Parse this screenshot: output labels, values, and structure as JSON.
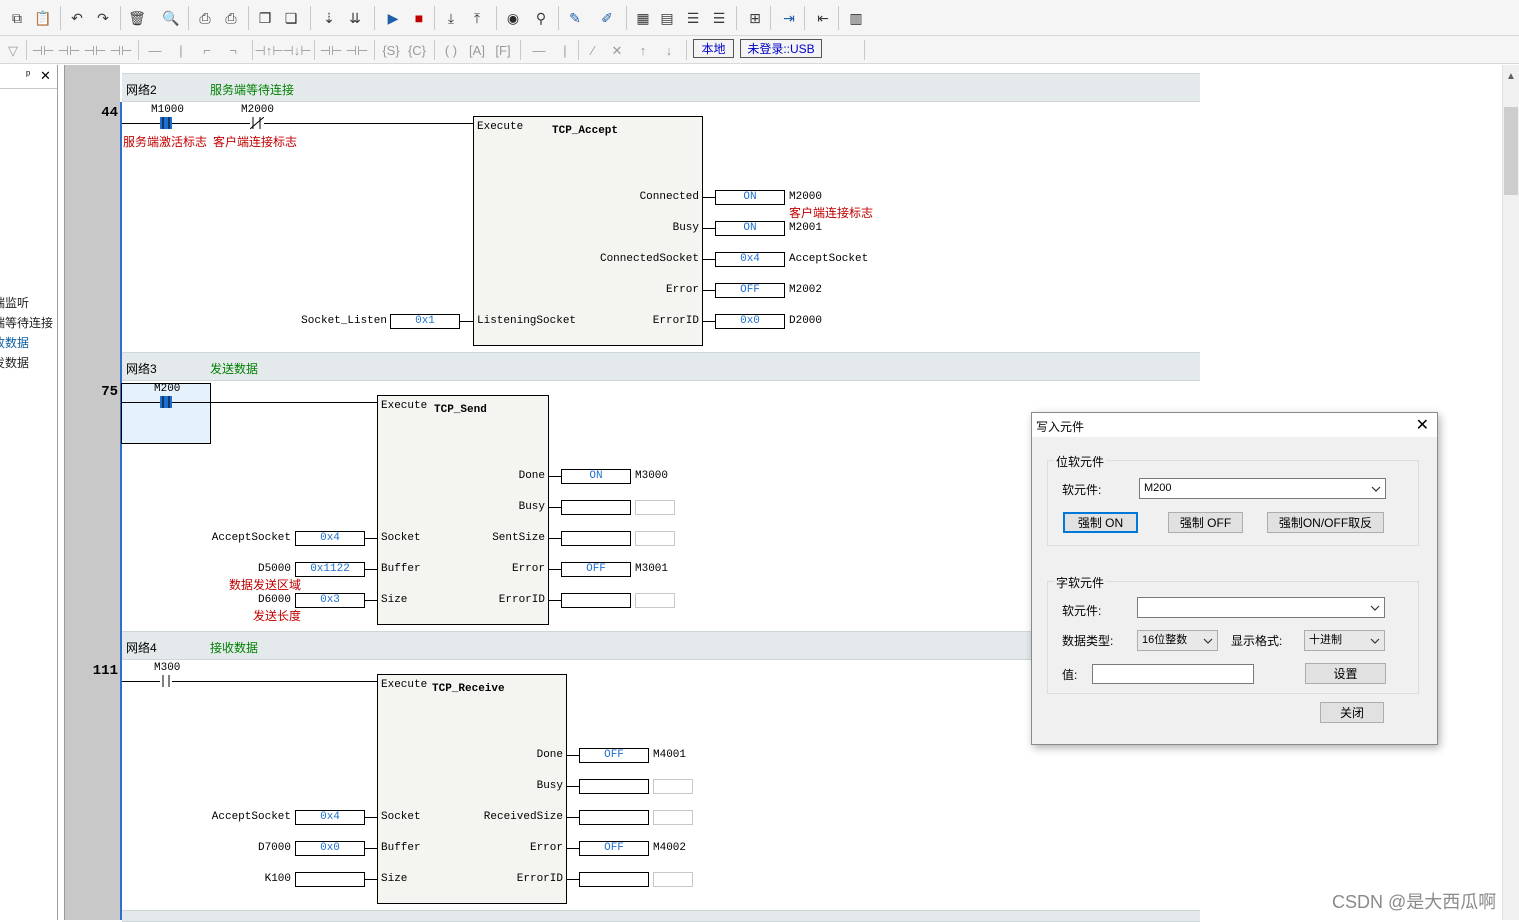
{
  "toolbar": {
    "mode_buttons": [
      {
        "label": "本地"
      },
      {
        "label": "未登录::USB"
      }
    ]
  },
  "left_panel": {
    "items": [
      {
        "label": "端监听"
      },
      {
        "label": "端等待连接"
      },
      {
        "label": "收数据"
      },
      {
        "label": "发数据"
      }
    ]
  },
  "networks": [
    {
      "title": "网络2",
      "comment": "服务端等待连接",
      "row": "44",
      "contacts": [
        {
          "tag": "M1000",
          "comment": "服务端激活标志"
        },
        {
          "tag": "M2000",
          "comment": "客户端连接标志"
        }
      ],
      "block": {
        "name": "TCP_Accept",
        "execute": "Execute",
        "inputs": [
          {
            "source": "Socket_Listen",
            "value": "0x1",
            "pin": "ListeningSocket"
          }
        ],
        "outputs": [
          {
            "pin": "Connected",
            "value": "ON",
            "target": "M2000",
            "comment": "客户端连接标志"
          },
          {
            "pin": "Busy",
            "value": "ON",
            "target": "M2001"
          },
          {
            "pin": "ConnectedSocket",
            "value": "0x4",
            "target": "AcceptSocket"
          },
          {
            "pin": "Error",
            "value": "OFF",
            "target": "M2002"
          },
          {
            "pin": "ErrorID",
            "value": "0x0",
            "target": "D2000"
          }
        ]
      }
    },
    {
      "title": "网络3",
      "comment": "发送数据",
      "row": "75",
      "contacts": [
        {
          "tag": "M200"
        }
      ],
      "block": {
        "name": "TCP_Send",
        "execute": "Execute",
        "inputs": [
          {
            "source": "AcceptSocket",
            "value": "0x4",
            "pin": "Socket"
          },
          {
            "source": "D5000",
            "value": "0x1122",
            "pin": "Buffer",
            "comment": "数据发送区域"
          },
          {
            "source": "D6000",
            "value": "0x3",
            "pin": "Size",
            "comment": "发送长度"
          }
        ],
        "outputs": [
          {
            "pin": "Done",
            "value": "ON",
            "target": "M3000"
          },
          {
            "pin": "Busy",
            "value": "",
            "target": ""
          },
          {
            "pin": "SentSize",
            "value": "",
            "target": ""
          },
          {
            "pin": "Error",
            "value": "OFF",
            "target": "M3001"
          },
          {
            "pin": "ErrorID",
            "value": "",
            "target": ""
          }
        ]
      }
    },
    {
      "title": "网络4",
      "comment": "接收数据",
      "row": "111",
      "contacts": [
        {
          "tag": "M300"
        }
      ],
      "block": {
        "name": "TCP_Receive",
        "execute": "Execute",
        "inputs": [
          {
            "source": "AcceptSocket",
            "value": "0x4",
            "pin": "Socket"
          },
          {
            "source": "D7000",
            "value": "0x0",
            "pin": "Buffer"
          },
          {
            "source": "K100",
            "value": "",
            "pin": "Size"
          }
        ],
        "outputs": [
          {
            "pin": "Done",
            "value": "OFF",
            "target": "M4001"
          },
          {
            "pin": "Busy",
            "value": "",
            "target": ""
          },
          {
            "pin": "ReceivedSize",
            "value": "",
            "target": ""
          },
          {
            "pin": "Error",
            "value": "OFF",
            "target": "M4002"
          },
          {
            "pin": "ErrorID",
            "value": "",
            "target": ""
          }
        ]
      }
    }
  ],
  "dialog": {
    "title": "写入元件",
    "bit_group": {
      "title": "位软元件",
      "device_label": "软元件:",
      "device_value": "M200",
      "buttons": [
        {
          "label": "强制 ON"
        },
        {
          "label": "强制 OFF"
        },
        {
          "label": "强制ON/OFF取反"
        }
      ]
    },
    "word_group": {
      "title": "字软元件",
      "device_label": "软元件:",
      "device_value": "",
      "type_label": "数据类型:",
      "type_value": "16位整数",
      "format_label": "显示格式:",
      "format_value": "十进制",
      "value_label": "值:",
      "value_value": "",
      "set_button": "设置"
    },
    "close_button": "关闭"
  },
  "watermark": "CSDN @是大西瓜啊",
  "colors": {
    "value_text": "#1e6fd0",
    "comment_red": "#c00000",
    "network_comment": "#008000",
    "power_rail": "#2f6fd0",
    "selected_contact": "#1e6fd0"
  }
}
